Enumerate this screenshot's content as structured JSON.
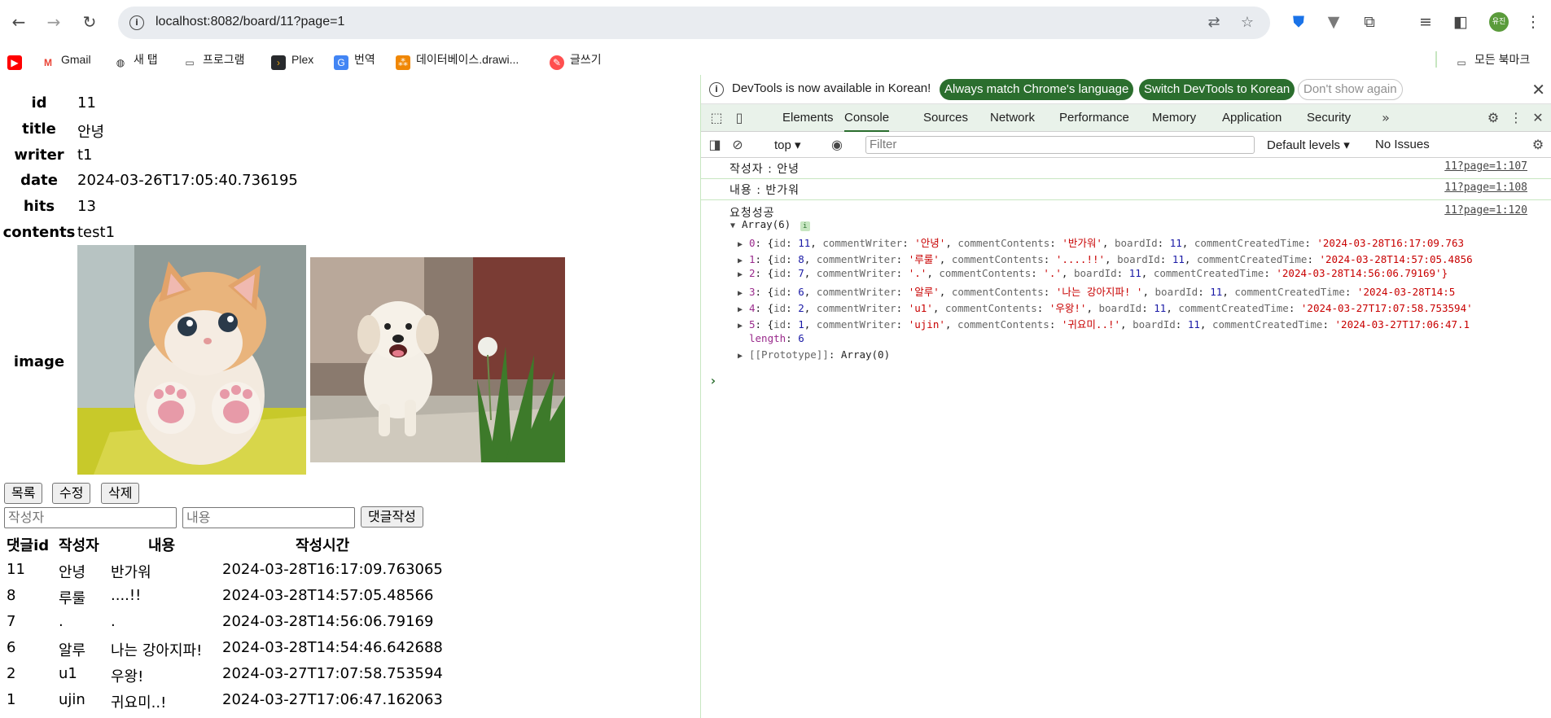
{
  "browser": {
    "url": "localhost:8082/board/11?page=1",
    "avatar_text": "유진",
    "bookmarks": [
      {
        "label": "",
        "icon": "youtube-icon",
        "color": "#ff0000"
      },
      {
        "label": "Gmail",
        "icon": "gmail-icon",
        "color": "#ea4335"
      },
      {
        "label": "새 탭",
        "icon": "globe-icon",
        "color": "#1f1f1f"
      },
      {
        "label": "프로그램",
        "icon": "folder-icon",
        "color": "#474747"
      },
      {
        "label": "Plex",
        "icon": "plex-icon",
        "color": "#e5a00d"
      },
      {
        "label": "번역",
        "icon": "translate-icon",
        "color": "#4285f4"
      },
      {
        "label": "데이터베이스.drawi...",
        "icon": "drawio-icon",
        "color": "#f08705"
      },
      {
        "label": "글쓰기",
        "icon": "write-icon",
        "color": "#ff4f4f"
      }
    ],
    "all_bookmarks_label": "모든 북마크"
  },
  "board": {
    "fields": [
      {
        "label": "id",
        "value": "11"
      },
      {
        "label": "title",
        "value": "안녕"
      },
      {
        "label": "writer",
        "value": "t1"
      },
      {
        "label": "date",
        "value": "2024-03-26T17:05:40.736195"
      },
      {
        "label": "hits",
        "value": "13"
      },
      {
        "label": "contents",
        "value": "test1"
      }
    ],
    "image_label": "image",
    "buttons": {
      "list": "목록",
      "edit": "수정",
      "delete": "삭제"
    },
    "comment_form": {
      "writer_placeholder": "작성자",
      "contents_placeholder": "내용",
      "submit": "댓글작성"
    },
    "comment_headers": [
      "댓글id",
      "작성자",
      "내용",
      "작성시간"
    ],
    "comments": [
      {
        "id": "11",
        "writer": "안녕",
        "contents": "반가워",
        "time": "2024-03-28T16:17:09.763065"
      },
      {
        "id": "8",
        "writer": "루룰",
        "contents": "....!!",
        "time": "2024-03-28T14:57:05.48566"
      },
      {
        "id": "7",
        "writer": ".",
        "contents": ".",
        "time": "2024-03-28T14:56:06.79169"
      },
      {
        "id": "6",
        "writer": "알루",
        "contents": "나는 강아지파!",
        "time": "2024-03-28T14:54:46.642688"
      },
      {
        "id": "2",
        "writer": "u1",
        "contents": "우왕!",
        "time": "2024-03-27T17:07:58.753594"
      },
      {
        "id": "1",
        "writer": "ujin",
        "contents": "귀요미..!",
        "time": "2024-03-27T17:06:47.162063"
      }
    ]
  },
  "devtools": {
    "info_message": "DevTools is now available in Korean!",
    "btn_always_match": "Always match Chrome's language",
    "btn_switch": "Switch DevTools to Korean",
    "btn_dont_show": "Don't show again",
    "tabs": [
      "Elements",
      "Console",
      "Sources",
      "Network",
      "Performance",
      "Memory",
      "Application",
      "Security"
    ],
    "active_tab": "Console",
    "context": "top",
    "filter_placeholder": "Filter",
    "levels": "Default levels",
    "issues": "No Issues",
    "logs": [
      {
        "text": "작성자 :  안녕",
        "source": "11?page=1:107"
      },
      {
        "text": "내용 :  반가워",
        "source": "11?page=1:108"
      },
      {
        "text": "요청성공",
        "source": "11?page=1:120"
      }
    ],
    "array_label": "Array(6)",
    "array_rows": [
      {
        "idx": "0",
        "id": "11",
        "writer": "'안녕'",
        "contents": "'반가워'",
        "board": "11",
        "time": "'2024-03-28T16:17:09.763"
      },
      {
        "idx": "1",
        "id": "8",
        "writer": "'루룰'",
        "contents": "'....!!'",
        "board": "11",
        "time": "'2024-03-28T14:57:05.4856"
      },
      {
        "idx": "2",
        "id": "7",
        "writer": "'.'",
        "contents": "'.'",
        "board": "11",
        "time": "'2024-03-28T14:56:06.79169'}"
      },
      {
        "idx": "3",
        "id": "6",
        "writer": "'알루'",
        "contents": "'나는 강아지파! '",
        "board": "11",
        "time": "'2024-03-28T14:5"
      },
      {
        "idx": "4",
        "id": "2",
        "writer": "'u1'",
        "contents": "'우왕!'",
        "board": "11",
        "time": "'2024-03-27T17:07:58.753594'"
      },
      {
        "idx": "5",
        "id": "1",
        "writer": "'ujin'",
        "contents": "'귀요미..!'",
        "board": "11",
        "time": "'2024-03-27T17:06:47.1"
      }
    ],
    "length_label": "length",
    "length_value": "6",
    "prototype": "[[Prototype]]",
    "prototype_value": "Array(0)"
  }
}
